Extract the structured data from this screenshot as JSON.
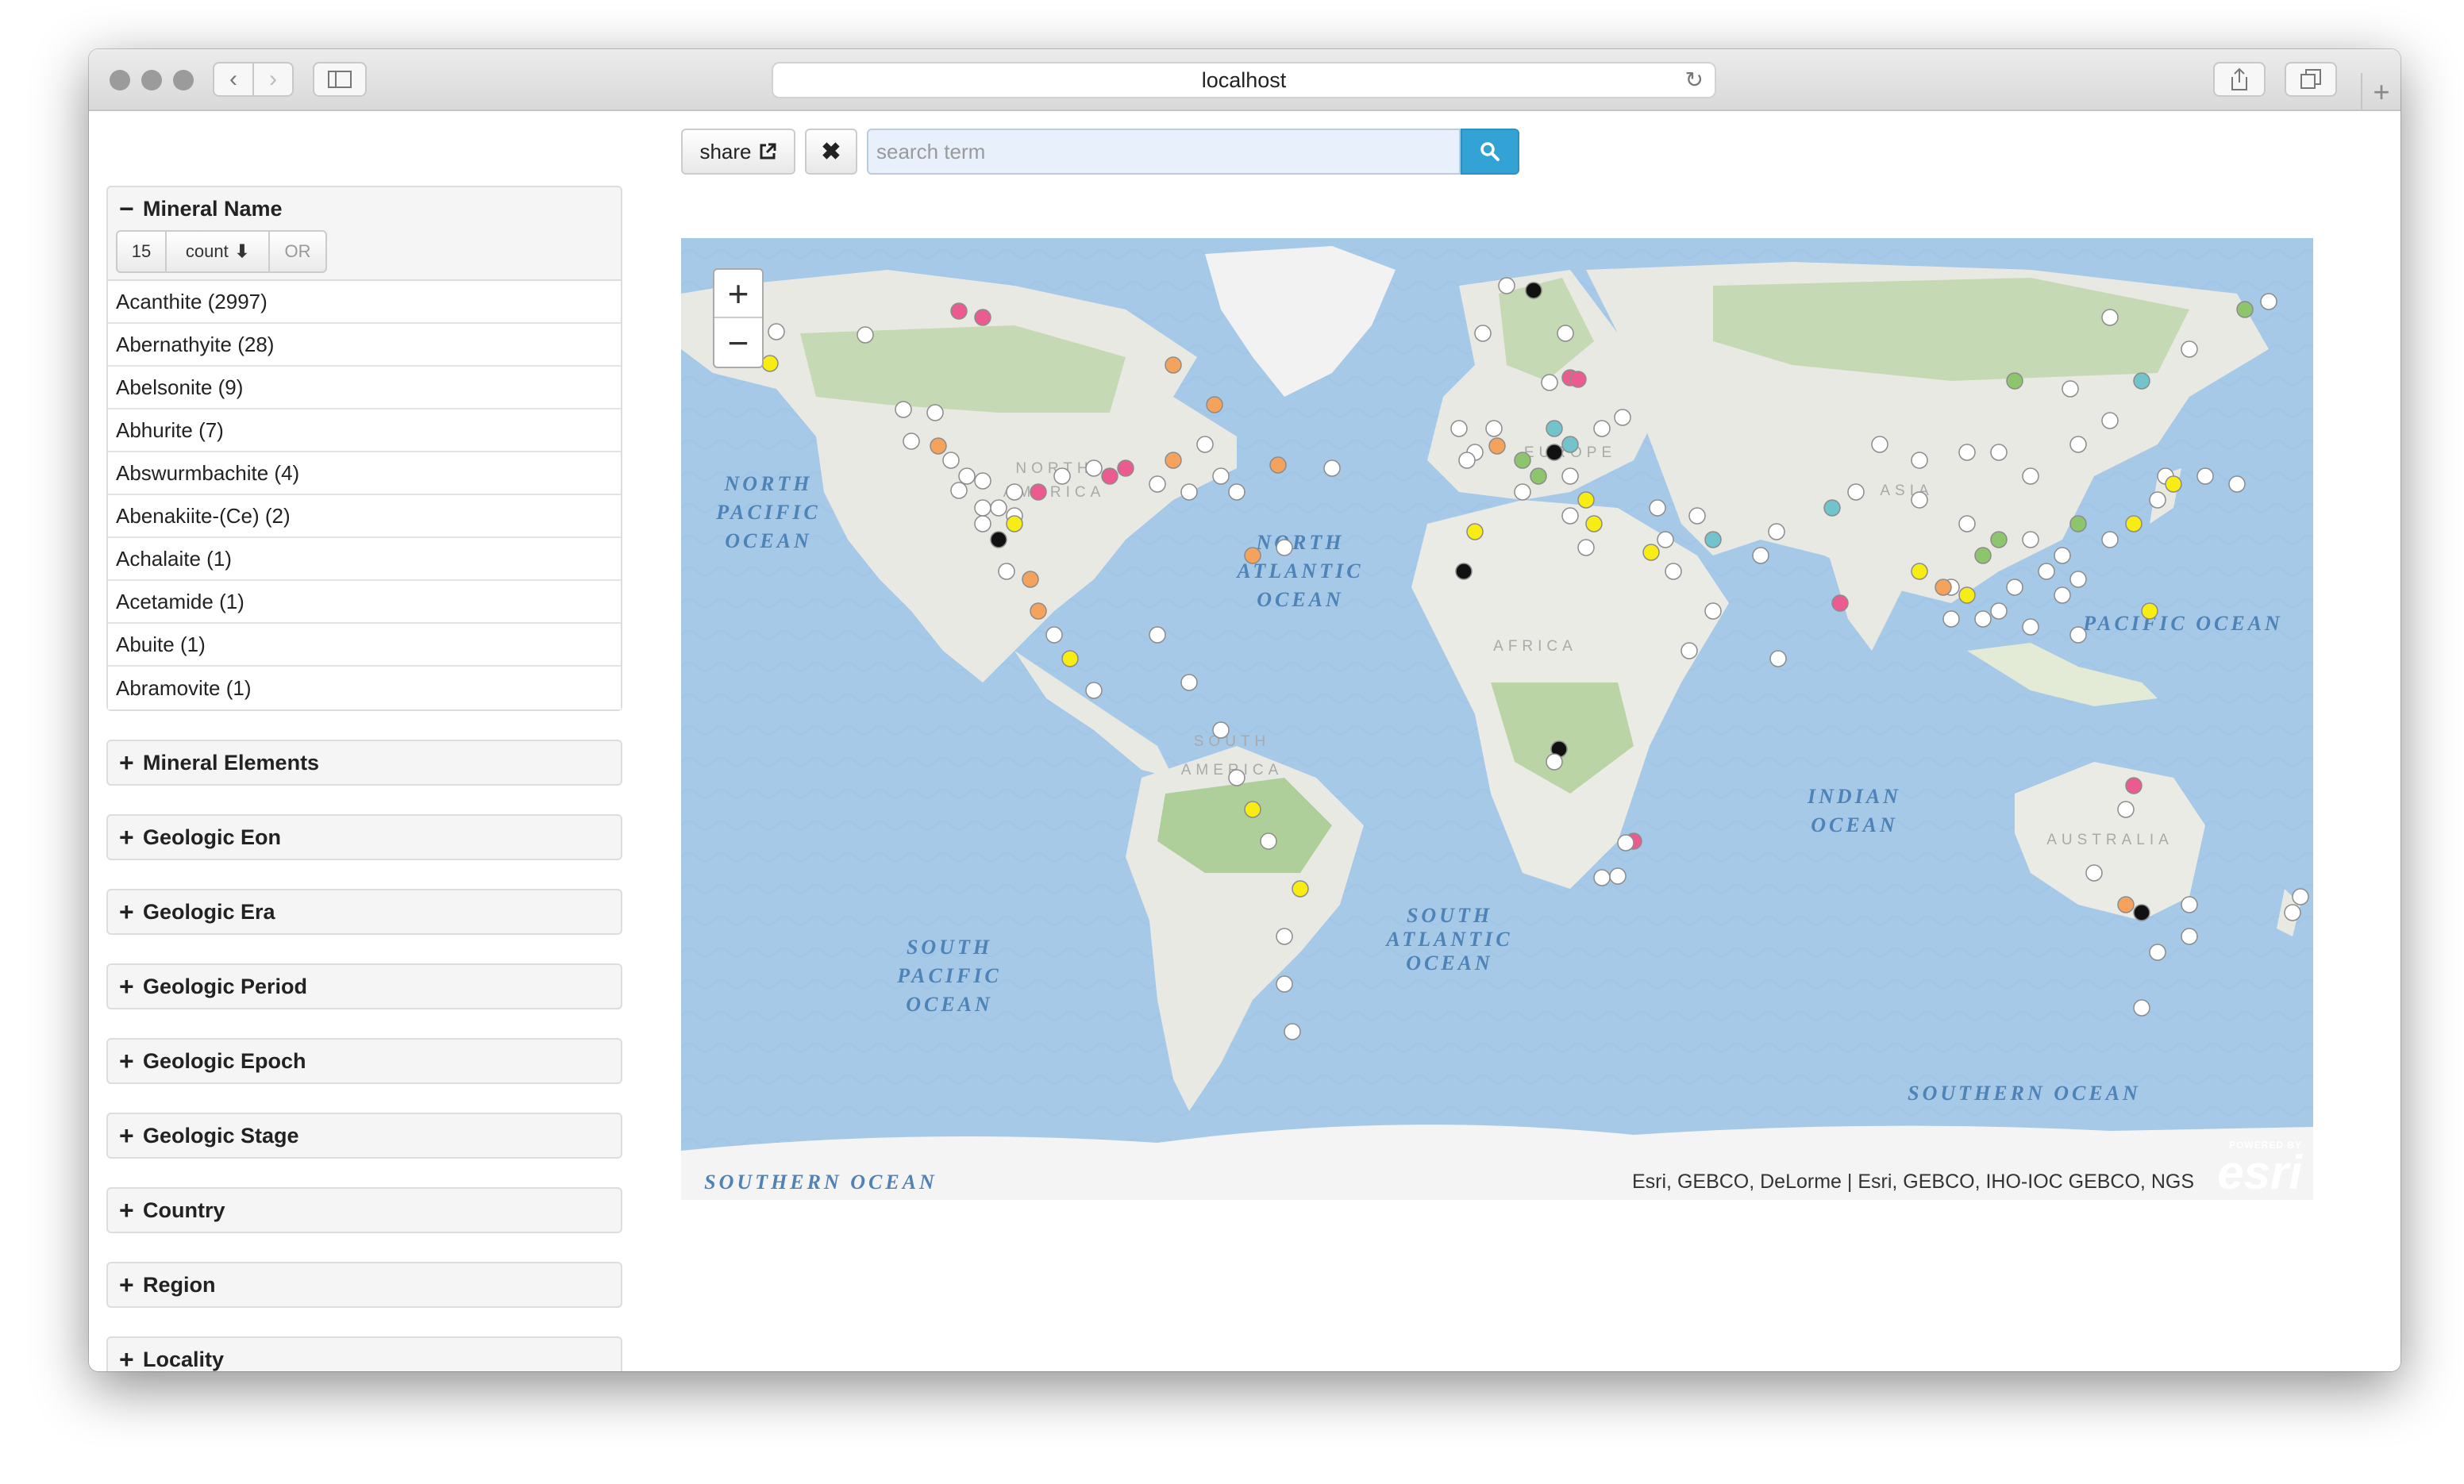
{
  "browser": {
    "url": "localhost",
    "back_icon": "chevron-left-icon",
    "forward_icon": "chevron-right-icon",
    "sidebar_icon": "sidebar-icon",
    "reload_icon": "reload-icon",
    "share_icon": "share-icon",
    "tabs_icon": "tabs-icon",
    "new_tab_label": "+"
  },
  "search": {
    "share_label": "share",
    "clear_label": "✖",
    "placeholder": "search term",
    "value": ""
  },
  "sidebar": {
    "mineral_name": {
      "title": "Mineral Name",
      "expanded_sign": "−",
      "limit": "15",
      "sort_label": "count",
      "operator": "OR",
      "items": [
        "Acanthite (2997)",
        "Abernathyite (28)",
        "Abelsonite (9)",
        "Abhurite (7)",
        "Abswurmbachite (4)",
        "Abenakiite-(Ce) (2)",
        "Achalaite (1)",
        "Acetamide (1)",
        "Abuite (1)",
        "Abramovite (1)"
      ]
    },
    "collapsed_sign": "+",
    "facets": [
      "Mineral Elements",
      "Geologic Eon",
      "Geologic Era",
      "Geologic Period",
      "Geologic Epoch",
      "Geologic Stage",
      "Country",
      "Region",
      "Locality"
    ]
  },
  "map": {
    "zoom_in": "+",
    "zoom_out": "−",
    "attribution": "Esri, GEBCO, DeLorme | Esri, GEBCO, IHO-IOC GEBCO, NGS",
    "esri_powered": "POWERED BY",
    "esri_logo": "esri",
    "ocean_labels": [
      "NORTH",
      "PACIFIC",
      "OCEAN",
      "NORTH",
      "ATLANTIC",
      "OCEAN",
      "SOUTH",
      "PACIFIC",
      "OCEAN",
      "SOUTH",
      "ATLANTIC",
      "OCEAN",
      "INDIAN",
      "OCEAN",
      "PACIFIC OCEAN",
      "SOUTHERN OCEAN",
      "SOUTHERN OCEAN"
    ],
    "continent_labels": [
      "AFRICA",
      "ASIA",
      "AUSTRALIA",
      "SOUTH",
      "AMERICA",
      "NORTH",
      "AMERICA",
      "EUROPE"
    ],
    "marker_colors": {
      "white": "#ffffff",
      "black": "#111111",
      "orange": "#f5a25d",
      "yellow": "#f7ec13",
      "pink": "#ec5b8f",
      "teal": "#71c3cc",
      "green": "#8cc56c"
    }
  }
}
